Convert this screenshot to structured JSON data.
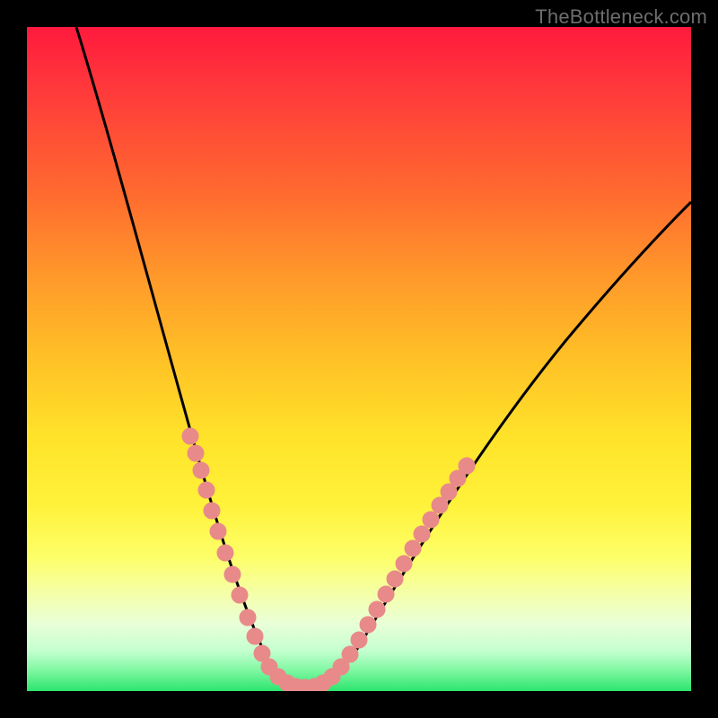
{
  "watermark": "TheBottleneck.com",
  "chart_data": {
    "type": "line",
    "title": "",
    "xlabel": "",
    "ylabel": "",
    "xlim": [
      0,
      100
    ],
    "ylim": [
      0,
      100
    ],
    "series": [
      {
        "name": "bottleneck-curve",
        "x": [
          5,
          10,
          15,
          20,
          23,
          26,
          28,
          30,
          32,
          34,
          35,
          36,
          37,
          38,
          39,
          40,
          41,
          42,
          43,
          45,
          48,
          52,
          56,
          60,
          65,
          70,
          75,
          80,
          85,
          90,
          95,
          100
        ],
        "values": [
          100,
          85,
          70,
          55,
          45,
          35,
          28,
          22,
          16,
          10,
          7,
          5,
          3,
          2,
          1,
          1,
          1,
          2,
          4,
          8,
          14,
          22,
          30,
          37,
          45,
          52,
          58,
          63,
          67,
          70,
          73,
          75
        ]
      }
    ],
    "highlight_ranges": [
      {
        "name": "left-cluster",
        "x_start": 23,
        "x_end": 30
      },
      {
        "name": "right-cluster",
        "x_start": 42,
        "x_end": 52
      }
    ],
    "colors": {
      "curve": "#000000",
      "highlight_dot": "#e88a8a",
      "gradient_top": "#ff1a3d",
      "gradient_bottom": "#2be56e"
    }
  }
}
